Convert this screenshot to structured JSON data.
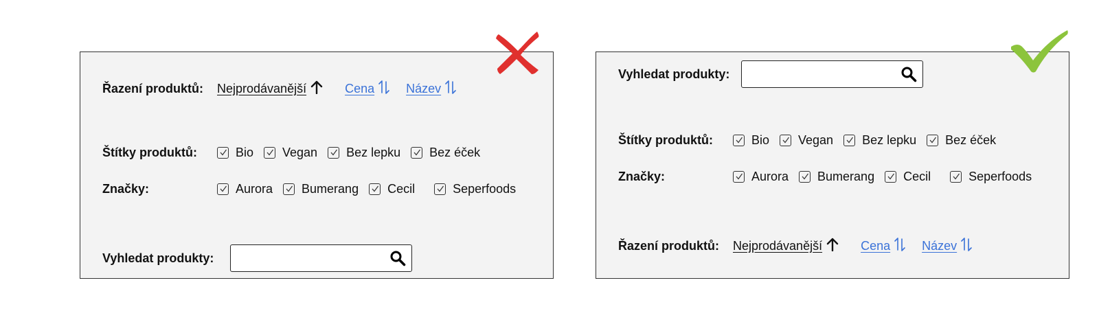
{
  "sort": {
    "label": "Řazení produktů:",
    "options": [
      {
        "text": "Nejprodávanější",
        "state": "active",
        "arrow": "up"
      },
      {
        "text": "Cena",
        "state": "link",
        "arrow": "updown"
      },
      {
        "text": "Název",
        "state": "link",
        "arrow": "updown"
      }
    ]
  },
  "tags": {
    "label": "Štítky produktů:",
    "items": [
      "Bio",
      "Vegan",
      "Bez lepku",
      "Bez éček"
    ]
  },
  "brands": {
    "label": "Značky:",
    "items": [
      "Aurora",
      "Bumerang",
      "Cecil",
      "Seperfoods"
    ]
  },
  "search": {
    "label": "Vyhledat produkty:",
    "value": "",
    "placeholder": ""
  },
  "colors": {
    "link": "#3a72d8",
    "panel_bg": "#f3f3f3",
    "wrong_mark": "#e0302e",
    "correct_mark": "#8cc43c"
  },
  "icons": {
    "wrong": "red-x-icon",
    "correct": "green-check-icon",
    "search": "magnifier-icon"
  }
}
